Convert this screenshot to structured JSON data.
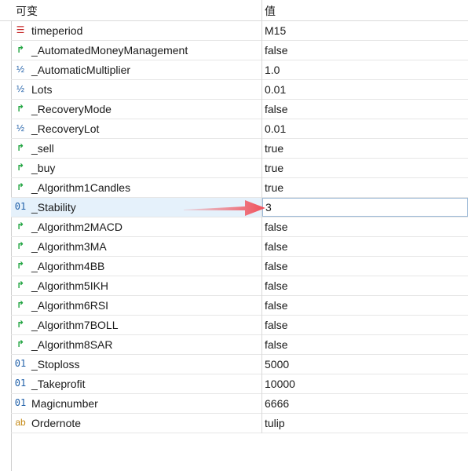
{
  "header": {
    "col_name": "可变",
    "col_value": "值"
  },
  "rows": [
    {
      "icon": "enum-icon",
      "glyph": "☰",
      "name": "timeperiod",
      "value": "M15"
    },
    {
      "icon": "bool-icon",
      "glyph": "↱",
      "name": "_AutomatedMoneyManagement",
      "value": "false"
    },
    {
      "icon": "double-icon",
      "glyph": "½",
      "name": "_AutomaticMultiplier",
      "value": "1.0"
    },
    {
      "icon": "double-icon",
      "glyph": "½",
      "name": "Lots",
      "value": "0.01"
    },
    {
      "icon": "bool-icon",
      "glyph": "↱",
      "name": "_RecoveryMode",
      "value": "false"
    },
    {
      "icon": "double-icon",
      "glyph": "½",
      "name": "_RecoveryLot",
      "value": "0.01"
    },
    {
      "icon": "bool-icon",
      "glyph": "↱",
      "name": "_sell",
      "value": "true"
    },
    {
      "icon": "bool-icon",
      "glyph": "↱",
      "name": "_buy",
      "value": "true"
    },
    {
      "icon": "bool-icon",
      "glyph": "↱",
      "name": "_Algorithm1Candles",
      "value": "true"
    },
    {
      "icon": "int-icon",
      "glyph": "01",
      "name": "_Stability",
      "value": "3"
    },
    {
      "icon": "bool-icon",
      "glyph": "↱",
      "name": "_Algorithm2MACD",
      "value": "false"
    },
    {
      "icon": "bool-icon",
      "glyph": "↱",
      "name": "_Algorithm3MA",
      "value": "false"
    },
    {
      "icon": "bool-icon",
      "glyph": "↱",
      "name": "_Algorithm4BB",
      "value": "false"
    },
    {
      "icon": "bool-icon",
      "glyph": "↱",
      "name": "_Algorithm5IKH",
      "value": "false"
    },
    {
      "icon": "bool-icon",
      "glyph": "↱",
      "name": "_Algorithm6RSI",
      "value": "false"
    },
    {
      "icon": "bool-icon",
      "glyph": "↱",
      "name": "_Algorithm7BOLL",
      "value": "false"
    },
    {
      "icon": "bool-icon",
      "glyph": "↱",
      "name": "_Algorithm8SAR",
      "value": "false"
    },
    {
      "icon": "int-icon",
      "glyph": "01",
      "name": "_Stoploss",
      "value": "5000"
    },
    {
      "icon": "int-icon",
      "glyph": "01",
      "name": "_Takeprofit",
      "value": "10000"
    },
    {
      "icon": "int-icon",
      "glyph": "01",
      "name": "Magicnumber",
      "value": "6666"
    },
    {
      "icon": "string-icon",
      "glyph": "ab",
      "name": "Ordernote",
      "value": "tulip"
    }
  ],
  "selected_row": "_Stability",
  "colors": {
    "arrow_annotation": "#f0505a",
    "selection": "#e5f1fb",
    "bool_icon": "#22a542",
    "num_icon": "#1f5fa8"
  }
}
